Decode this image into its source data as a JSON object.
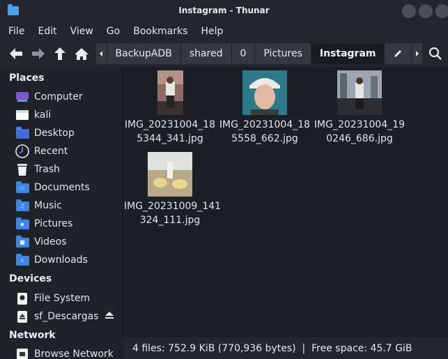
{
  "window": {
    "title": "Instagram - Thunar"
  },
  "menubar": [
    "File",
    "Edit",
    "View",
    "Go",
    "Bookmarks",
    "Help"
  ],
  "toolbar": {
    "icons": [
      "back-icon",
      "forward-icon",
      "up-icon",
      "home-icon",
      "search-icon"
    ]
  },
  "pathbar": {
    "crumbs": [
      "BackupADB",
      "shared",
      "0",
      "Pictures",
      "Instagram"
    ],
    "active": "Instagram"
  },
  "sidebar": {
    "places_title": "Places",
    "places": [
      {
        "label": "Computer",
        "icon": "computer-icon"
      },
      {
        "label": "kali",
        "icon": "home-folder-icon"
      },
      {
        "label": "Desktop",
        "icon": "desktop-folder-icon"
      },
      {
        "label": "Recent",
        "icon": "recent-icon"
      },
      {
        "label": "Trash",
        "icon": "trash-icon"
      },
      {
        "label": "Documents",
        "icon": "documents-folder-icon"
      },
      {
        "label": "Music",
        "icon": "music-folder-icon"
      },
      {
        "label": "Pictures",
        "icon": "pictures-folder-icon"
      },
      {
        "label": "Videos",
        "icon": "videos-folder-icon"
      },
      {
        "label": "Downloads",
        "icon": "downloads-folder-icon"
      }
    ],
    "devices_title": "Devices",
    "devices": [
      {
        "label": "File System",
        "icon": "drive-icon"
      },
      {
        "label": "sf_Descargas",
        "icon": "drive-icon"
      }
    ],
    "network_title": "Network",
    "network": [
      {
        "label": "Browse Network",
        "icon": "network-icon"
      }
    ]
  },
  "files": [
    {
      "name_l1": "IMG_20231004_18",
      "name_l2": "5344_341.jpg"
    },
    {
      "name_l1": "IMG_20231004_18",
      "name_l2": "5558_662.jpg"
    },
    {
      "name_l1": "IMG_20231004_19",
      "name_l2": "0246_686.jpg"
    },
    {
      "name_l1": "IMG_20231009_141",
      "name_l2": "324_111.jpg"
    }
  ],
  "status": {
    "text": "4 files: 752.9 KiB (770,936 bytes)  |  Free space: 45.7 GiB"
  },
  "colors": {
    "accent": "#3d86e8",
    "background": "#1c1f26",
    "sidebar": "#1f2229"
  }
}
